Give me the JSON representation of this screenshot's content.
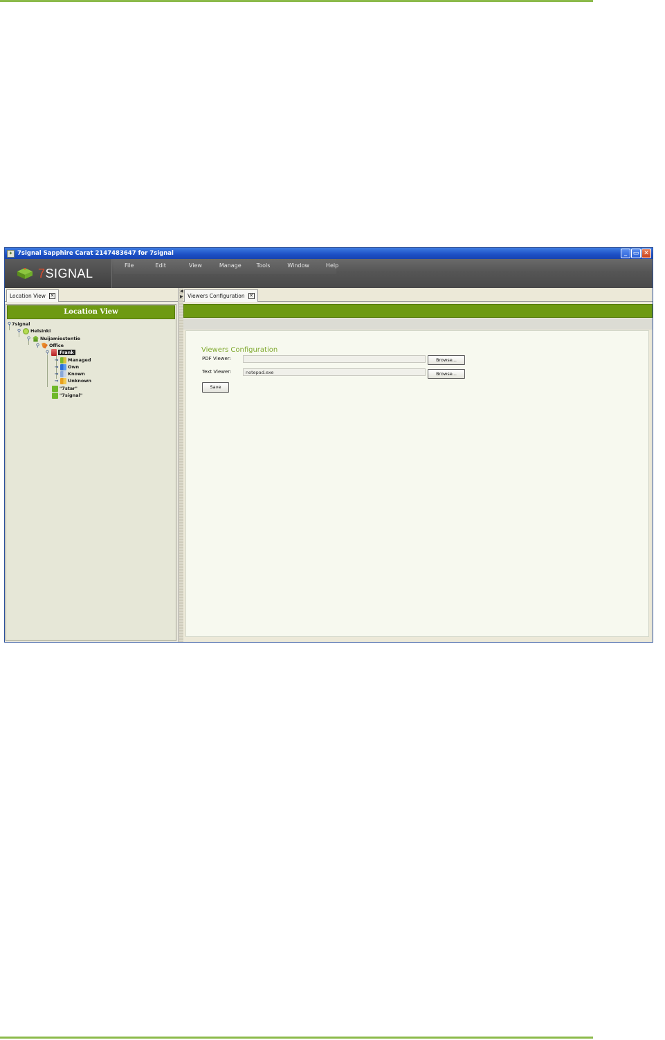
{
  "window": {
    "title": "7signal Sapphire Carat  2147483647 for 7signal",
    "minimize_symbol": "_",
    "maximize_symbol": "▭",
    "close_symbol": "✕"
  },
  "brand": {
    "logo_seven": "7",
    "logo_word": "SIGNAL",
    "accent_color": "#6e9a12",
    "rule_color": "#8cba4b"
  },
  "menu": [
    "File",
    "Edit",
    "View",
    "Manage",
    "Tools",
    "Window",
    "Help"
  ],
  "location_view": {
    "tab_label": "Location View",
    "tab_close": "✕",
    "header": "Location View",
    "tree": [
      {
        "label": "7signal",
        "icon": "root-pin-icon"
      },
      {
        "label": "Helsinki",
        "icon": "city-icon"
      },
      {
        "label": "Nuijamiestentie",
        "icon": "building-icon"
      },
      {
        "label": "Office",
        "icon": "office-icon"
      },
      {
        "label": "Frank",
        "icon": "person-icon"
      },
      {
        "label": "Managed",
        "icon": "managed-network-icon"
      },
      {
        "label": "Own",
        "icon": "own-network-icon"
      },
      {
        "label": "Known",
        "icon": "known-network-icon"
      },
      {
        "label": "Unknown",
        "icon": "unknown-network-icon"
      },
      {
        "label": "\"7star\"",
        "icon": "signal-icon"
      },
      {
        "label": "\"7signal\"",
        "icon": "signal-icon"
      }
    ]
  },
  "viewers_config": {
    "tab_label": "Viewers Configuration",
    "tab_close": "✕",
    "title": "Viewers Configuration",
    "pdf_label": "PDF Viewer:",
    "pdf_value": "",
    "text_label": "Text Viewer:",
    "text_value": "notepad.exe",
    "browse_label": "Browse...",
    "save_label": "Save"
  }
}
